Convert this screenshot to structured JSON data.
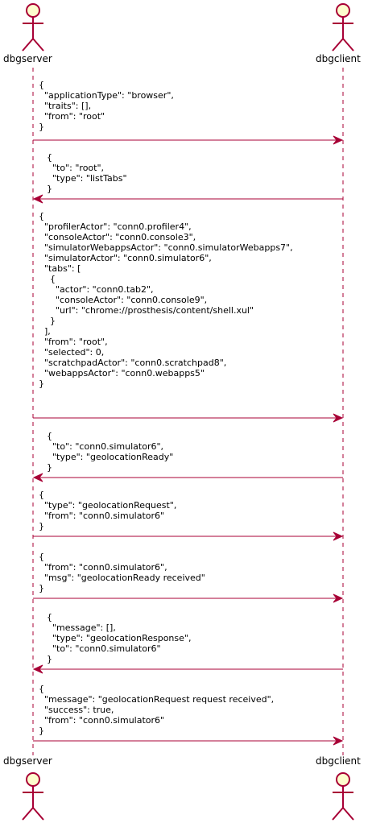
{
  "actors": {
    "left": {
      "name": "dbgserver"
    },
    "right": {
      "name": "dbgclient"
    }
  },
  "colors": {
    "lifeline": "#A80036",
    "actor_fill": "#FEFECE",
    "actor_stroke": "#A80036",
    "arrow": "#A80036",
    "text": "#000000"
  },
  "messages": [
    {
      "direction": "to-right",
      "text": "{\n  \"applicationType\": \"browser\",\n  \"traits\": [],\n  \"from\": \"root\"\n}"
    },
    {
      "direction": "to-left",
      "text": "{\n  \"to\": \"root\",\n  \"type\": \"listTabs\"\n}"
    },
    {
      "direction": "to-right",
      "text": "{\n  \"profilerActor\": \"conn0.profiler4\",\n  \"consoleActor\": \"conn0.console3\",\n  \"simulatorWebappsActor\": \"conn0.simulatorWebapps7\",\n  \"simulatorActor\": \"conn0.simulator6\",\n  \"tabs\": [\n    {\n      \"actor\": \"conn0.tab2\",\n      \"consoleActor\": \"conn0.console9\",\n      \"url\": \"chrome://prosthesis/content/shell.xul\"\n    }\n  ],\n  \"from\": \"root\",\n  \"selected\": 0,\n  \"scratchpadActor\": \"conn0.scratchpad8\",\n  \"webappsActor\": \"conn0.webapps5\"\n}"
    },
    {
      "direction": "to-left",
      "text": "{\n  \"to\": \"conn0.simulator6\",\n  \"type\": \"geolocationReady\"\n}"
    },
    {
      "direction": "to-right",
      "text": "{\n  \"type\": \"geolocationRequest\",\n  \"from\": \"conn0.simulator6\"\n}"
    },
    {
      "direction": "to-right",
      "text": "{\n  \"from\": \"conn0.simulator6\",\n  \"msg\": \"geolocationReady received\"\n}"
    },
    {
      "direction": "to-left",
      "text": "{\n  \"message\": [],\n  \"type\": \"geolocationResponse\",\n  \"to\": \"conn0.simulator6\"\n}"
    },
    {
      "direction": "to-right",
      "text": "{\n  \"message\": \"geolocationRequest request received\",\n  \"success\": true,\n  \"from\": \"conn0.simulator6\"\n}"
    }
  ]
}
